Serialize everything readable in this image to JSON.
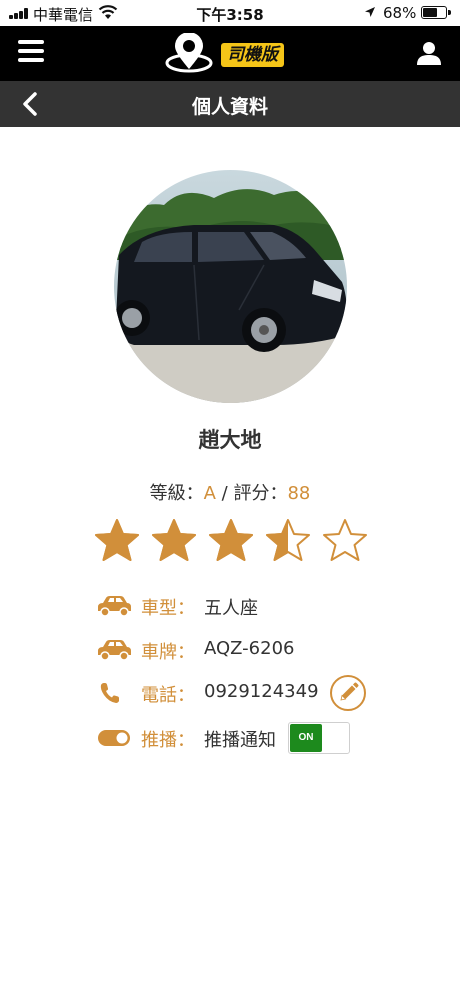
{
  "status_bar": {
    "carrier": "中華電信",
    "time": "下午3:58",
    "battery_pct": "68%",
    "battery_level": 0.68,
    "icons": [
      "signal-icon",
      "wifi-icon",
      "location-arrow-icon",
      "battery-icon"
    ]
  },
  "header": {
    "logo_badge": "司機版",
    "icons": [
      "menu-icon",
      "logo-pin-icon",
      "user-icon"
    ]
  },
  "subheader": {
    "title": "個人資料",
    "icons": [
      "back-chevron-icon"
    ]
  },
  "profile": {
    "name": "趙大地",
    "grade_label": "等級：",
    "grade": "A",
    "separator": " / ",
    "score_label": "評分：",
    "score": "88",
    "stars": 3.5,
    "stars_max": 5
  },
  "details": {
    "car_type": {
      "icon": "car-icon",
      "label": "車型：",
      "value": "五人座"
    },
    "plate": {
      "icon": "car-icon",
      "label": "車牌：",
      "value": "AQZ-6206"
    },
    "phone": {
      "icon": "phone-icon",
      "label": "電話：",
      "value": "0929124349",
      "edit_icon": "pencil-icon"
    },
    "push": {
      "icon": "toggle-icon",
      "label": "推播：",
      "value": "推播通知",
      "toggle_label": "ON",
      "toggle_on": true
    }
  },
  "colors": {
    "accent": "#d18f3a",
    "header_bg": "#000000",
    "subheader_bg": "#333333",
    "toggle_on": "#1d8a1d",
    "logo_yellow": "#f5c518"
  }
}
